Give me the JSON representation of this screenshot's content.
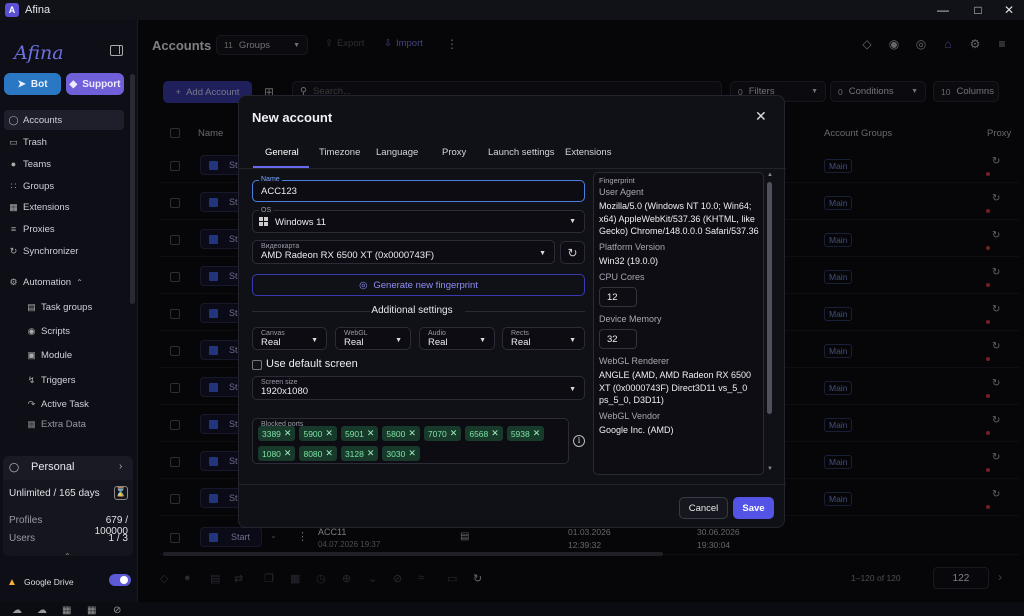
{
  "app": {
    "title": "Afina",
    "logo_letter": "A"
  },
  "sidebar": {
    "brand": "Afina",
    "bot_label": "Bot",
    "support_label": "Support",
    "items": [
      {
        "label": "Accounts",
        "icon": "user-circle-icon"
      },
      {
        "label": "Trash",
        "icon": "trash-icon"
      },
      {
        "label": "Teams",
        "icon": "users-icon"
      },
      {
        "label": "Groups",
        "icon": "groups-icon"
      },
      {
        "label": "Extensions",
        "icon": "puzzle-icon"
      },
      {
        "label": "Proxies",
        "icon": "proxy-icon"
      },
      {
        "label": "Synchronizer",
        "icon": "sync-icon"
      }
    ],
    "automation": {
      "label": "Automation",
      "items": [
        {
          "label": "Task groups"
        },
        {
          "label": "Scripts"
        },
        {
          "label": "Module"
        },
        {
          "label": "Triggers"
        },
        {
          "label": "Active Task"
        },
        {
          "label": "Extra Data"
        }
      ]
    },
    "plan": {
      "name": "Personal",
      "unlimited": "Unlimited / 165 days",
      "profiles_label": "Profiles",
      "profiles_value": "679 / 100000",
      "users_label": "Users",
      "users_value": "1 / 3"
    },
    "google_drive_label": "Google Drive"
  },
  "toolbar": {
    "title": "Accounts",
    "groups_count": "11",
    "groups_label": "Groups",
    "export_label": "Export",
    "import_label": "Import",
    "add_account_label": "Add Account",
    "search_placeholder": "Search...",
    "filters_count": "0",
    "filters_label": "Filters",
    "conditions_count": "0",
    "conditions_label": "Conditions",
    "columns_count": "10",
    "columns_label": "Columns"
  },
  "table": {
    "headers": {
      "name": "Name",
      "account_groups": "Account Groups",
      "proxy": "Proxy"
    },
    "row_group": "Main",
    "row_start_stub": "St",
    "last_row": {
      "start_label": "Start",
      "name": "ACC11",
      "date1": "04.07.2026 19:37",
      "date2": "01.03.2026",
      "time2": "12:39:32",
      "date3": "30.06.2026",
      "time3": "19:30:04"
    }
  },
  "footer": {
    "range": "1–120 of 120",
    "page": "122"
  },
  "modal": {
    "title": "New account",
    "tabs": [
      "General",
      "Timezone",
      "Language",
      "Proxy",
      "Launch settings",
      "Extensions"
    ],
    "name_label": "Name",
    "name_value": "ACC123",
    "os_label": "OS",
    "os_value": "Windows 11",
    "gpu_label": "Видеокарта",
    "gpu_value": "AMD Radeon RX 6500 XT (0x0000743F)",
    "generate_label": "Generate new fingerprint",
    "additional_label": "Additional settings",
    "noise": [
      {
        "label": "Canvas",
        "value": "Real"
      },
      {
        "label": "WebGL",
        "value": "Real"
      },
      {
        "label": "Audio",
        "value": "Real"
      },
      {
        "label": "Rects",
        "value": "Real"
      }
    ],
    "default_screen_label": "Use default screen",
    "screen_size_label": "Screen size",
    "screen_size_value": "1920x1080",
    "blocked_ports_label": "Blocked ports",
    "ports": [
      "3389",
      "5900",
      "5901",
      "5800",
      "7070",
      "6568",
      "5938",
      "1080",
      "8080",
      "3128",
      "3030"
    ],
    "fingerprint": {
      "title": "Fingerprint",
      "ua_label": "User Agent",
      "ua_value": "Mozilla/5.0 (Windows NT 10.0; Win64; x64) AppleWebKit/537.36 (KHTML, like Gecko) Chrome/148.0.0.0 Safari/537.36",
      "platform_label": "Platform Version",
      "platform_value": "Win32 (19.0.0)",
      "cores_label": "CPU Cores",
      "cores_value": "12",
      "memory_label": "Device Memory",
      "memory_value": "32",
      "renderer_label": "WebGL Renderer",
      "renderer_value": "ANGLE (AMD, AMD Radeon RX 6500 XT (0x0000743F) Direct3D11 vs_5_0 ps_5_0, D3D11)",
      "vendor_label": "WebGL Vendor",
      "vendor_value": "Google Inc. (AMD)"
    },
    "cancel_label": "Cancel",
    "save_label": "Save"
  }
}
